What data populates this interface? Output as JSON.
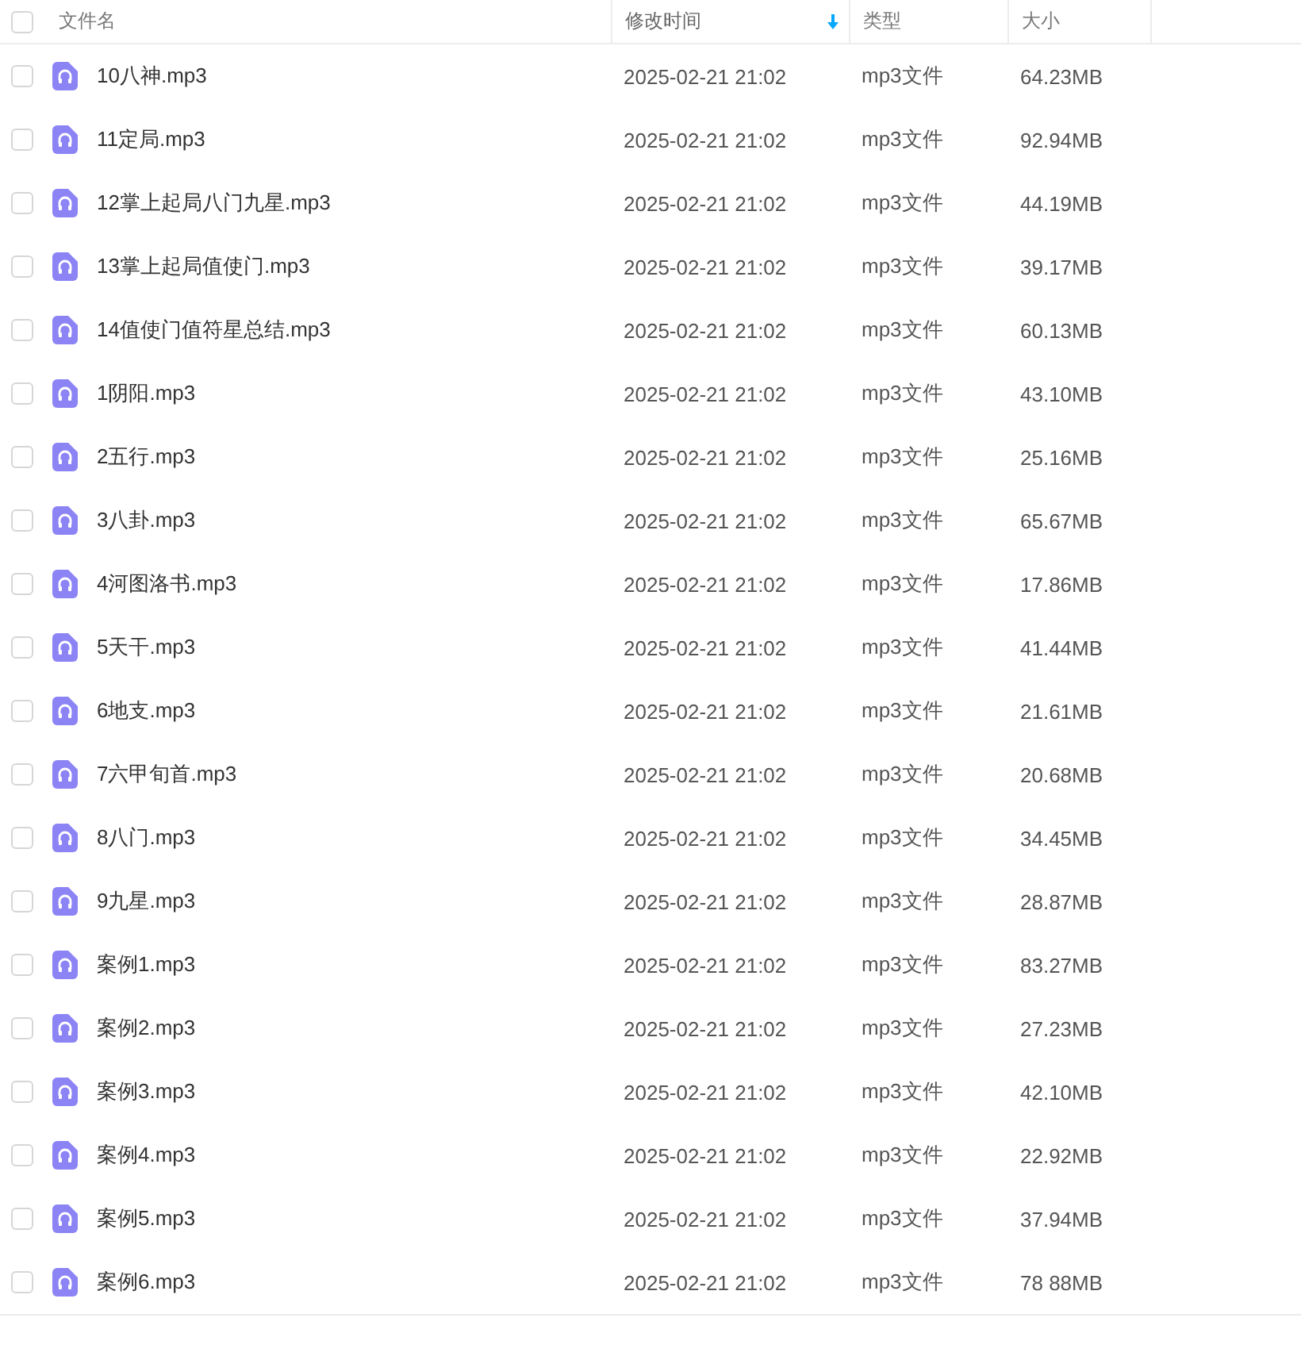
{
  "header": {
    "checked": false,
    "columns": [
      {
        "label": "文件名",
        "sorted": false
      },
      {
        "label": "修改时间",
        "sorted": true
      },
      {
        "label": "类型",
        "sorted": false
      },
      {
        "label": "大小",
        "sorted": false
      }
    ]
  },
  "rows": [
    {
      "name": "10八神.mp3",
      "time": "2025-02-21 21:02",
      "type": "mp3文件",
      "size": "64.23MB",
      "checked": false
    },
    {
      "name": "11定局.mp3",
      "time": "2025-02-21 21:02",
      "type": "mp3文件",
      "size": "92.94MB",
      "checked": false
    },
    {
      "name": "12掌上起局八门九星.mp3",
      "time": "2025-02-21 21:02",
      "type": "mp3文件",
      "size": "44.19MB",
      "checked": false
    },
    {
      "name": "13掌上起局值使门.mp3",
      "time": "2025-02-21 21:02",
      "type": "mp3文件",
      "size": "39.17MB",
      "checked": false
    },
    {
      "name": "14值使门值符星总结.mp3",
      "time": "2025-02-21 21:02",
      "type": "mp3文件",
      "size": "60.13MB",
      "checked": false
    },
    {
      "name": "1阴阳.mp3",
      "time": "2025-02-21 21:02",
      "type": "mp3文件",
      "size": "43.10MB",
      "checked": false
    },
    {
      "name": "2五行.mp3",
      "time": "2025-02-21 21:02",
      "type": "mp3文件",
      "size": "25.16MB",
      "checked": false
    },
    {
      "name": "3八卦.mp3",
      "time": "2025-02-21 21:02",
      "type": "mp3文件",
      "size": "65.67MB",
      "checked": false
    },
    {
      "name": "4河图洛书.mp3",
      "time": "2025-02-21 21:02",
      "type": "mp3文件",
      "size": "17.86MB",
      "checked": false
    },
    {
      "name": "5天干.mp3",
      "time": "2025-02-21 21:02",
      "type": "mp3文件",
      "size": "41.44MB",
      "checked": false
    },
    {
      "name": "6地支.mp3",
      "time": "2025-02-21 21:02",
      "type": "mp3文件",
      "size": "21.61MB",
      "checked": false
    },
    {
      "name": "7六甲旬首.mp3",
      "time": "2025-02-21 21:02",
      "type": "mp3文件",
      "size": "20.68MB",
      "checked": false
    },
    {
      "name": "8八门.mp3",
      "time": "2025-02-21 21:02",
      "type": "mp3文件",
      "size": "34.45MB",
      "checked": false
    },
    {
      "name": "9九星.mp3",
      "time": "2025-02-21 21:02",
      "type": "mp3文件",
      "size": "28.87MB",
      "checked": false
    },
    {
      "name": "案例1.mp3",
      "time": "2025-02-21 21:02",
      "type": "mp3文件",
      "size": "83.27MB",
      "checked": false
    },
    {
      "name": "案例2.mp3",
      "time": "2025-02-21 21:02",
      "type": "mp3文件",
      "size": "27.23MB",
      "checked": false
    },
    {
      "name": "案例3.mp3",
      "time": "2025-02-21 21:02",
      "type": "mp3文件",
      "size": "42.10MB",
      "checked": false
    },
    {
      "name": "案例4.mp3",
      "time": "2025-02-21 21:02",
      "type": "mp3文件",
      "size": "22.92MB",
      "checked": false
    },
    {
      "name": "案例5.mp3",
      "time": "2025-02-21 21:02",
      "type": "mp3文件",
      "size": "37.94MB",
      "checked": false
    },
    {
      "name": "案例6.mp3",
      "time": "2025-02-21 21:02",
      "type": "mp3文件",
      "size": "78 88MB",
      "checked": false
    }
  ]
}
